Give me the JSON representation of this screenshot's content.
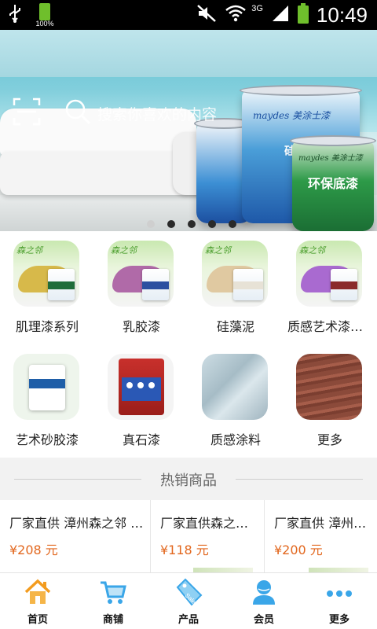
{
  "status_bar": {
    "battery_small_label": "100%",
    "network_label": "3G",
    "time": "10:49"
  },
  "banner": {
    "search_placeholder": "搜索你喜欢的内容",
    "bucket_labels": [
      "硅藻泥",
      "环保底漆"
    ],
    "brand_text": "maydes 美涂士漆",
    "slide_count": 5,
    "active_slide": 0
  },
  "categories": [
    {
      "label": "肌理漆系列",
      "icon": "texture-paint-product-icon",
      "swatch": "#d7b94a"
    },
    {
      "label": "乳胶漆",
      "icon": "latex-paint-product-icon",
      "swatch": "#b06aa8"
    },
    {
      "label": "硅藻泥",
      "icon": "diatom-mud-product-icon",
      "swatch": "#e0c9a1"
    },
    {
      "label": "质感艺术漆系列",
      "icon": "art-paint-product-icon",
      "swatch": "#a96ad0"
    },
    {
      "label": "艺术砂胶漆",
      "icon": "sand-paint-bucket-icon",
      "swatch": "#ffffff"
    },
    {
      "label": "真石漆",
      "icon": "stone-paint-can-icon",
      "swatch": "#c8302c"
    },
    {
      "label": "质感涂料",
      "icon": "textured-coating-icon",
      "swatch": "#b9cdd6"
    },
    {
      "label": "更多",
      "icon": "wood-texture-icon",
      "swatch": "#8b4a3a"
    }
  ],
  "hot": {
    "title": "热销商品",
    "products": [
      {
        "name": "厂家直供 漳州森之邻 肌理漆",
        "price": "¥208 元"
      },
      {
        "name": "厂家直供森之邻 乳胶漆",
        "price": "¥118 元"
      },
      {
        "name": "厂家直供 漳州森之邻",
        "price": "¥200 元"
      }
    ]
  },
  "tabs": [
    {
      "label": "首页",
      "icon": "home-icon"
    },
    {
      "label": "商铺",
      "icon": "shopping-cart-icon"
    },
    {
      "label": "产品",
      "icon": "sale-tag-icon"
    },
    {
      "label": "会员",
      "icon": "member-person-icon"
    },
    {
      "label": "更多",
      "icon": "more-dots-icon"
    }
  ],
  "colors": {
    "price": "#e2671e",
    "tab_icon": "#3aa6e8",
    "home_icon": "#f39c1f"
  }
}
